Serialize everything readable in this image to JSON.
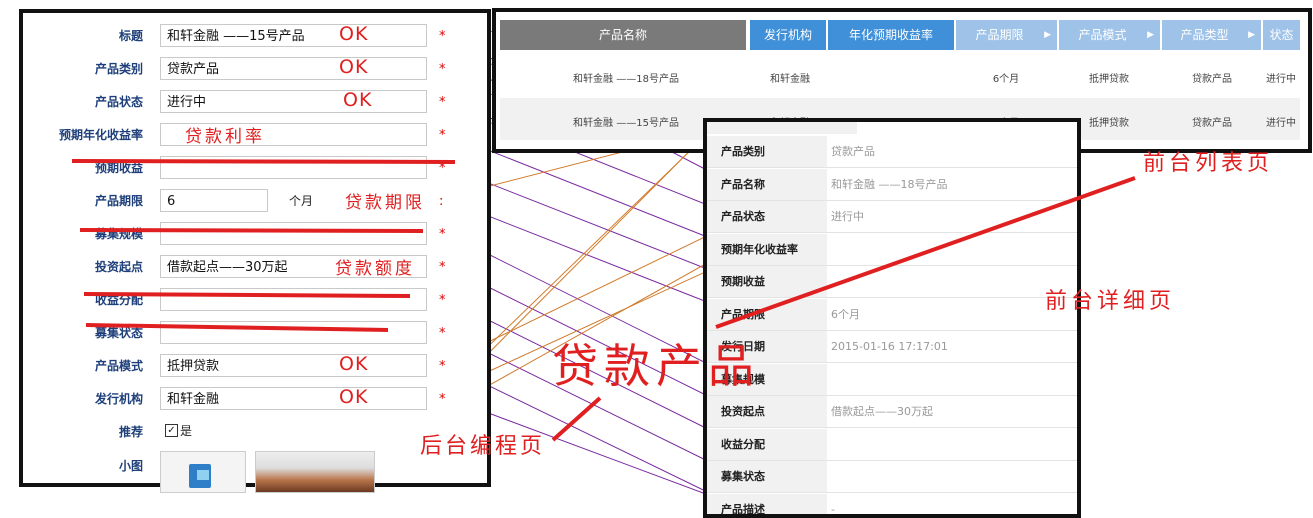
{
  "admin_form": {
    "rows": [
      {
        "label": "标题",
        "value": "和轩金融 ——15号产品",
        "star": "*",
        "note": "OK"
      },
      {
        "label": "产品类别",
        "value": "贷款产品",
        "star": "*",
        "note": "OK"
      },
      {
        "label": "产品状态",
        "value": "进行中",
        "star": "*",
        "note": "OK"
      },
      {
        "label": "预期年化收益率",
        "value": "",
        "star": "*",
        "note": "贷款利率"
      },
      {
        "label": "预期收益",
        "value": "",
        "star": "*",
        "note": ""
      },
      {
        "label": "产品期限",
        "value": "6",
        "unit": "个月",
        "star": ":",
        "note": "贷款期限"
      },
      {
        "label": "募集规模",
        "value": "",
        "star": "*",
        "note": ""
      },
      {
        "label": "投资起点",
        "value": "借款起点——30万起",
        "star": "*",
        "note": "贷款额度"
      },
      {
        "label": "收益分配",
        "value": "",
        "star": "*",
        "note": ""
      },
      {
        "label": "募集状态",
        "value": "",
        "star": "*",
        "note": ""
      },
      {
        "label": "产品模式",
        "value": "抵押贷款",
        "star": "*",
        "note": "OK"
      },
      {
        "label": "发行机构",
        "value": "和轩金融",
        "star": "*",
        "note": "OK"
      }
    ],
    "recommend": {
      "label": "推荐",
      "checkbox": "✓",
      "option": "是"
    },
    "thumbnail": {
      "label": "小图"
    }
  },
  "list_page": {
    "headers": [
      "产品名称",
      "发行机构",
      "年化预期收益率",
      "产品期限",
      "产品模式",
      "产品类型",
      "状态"
    ],
    "header_colors": [
      "#7a7a7a",
      "#3f8fd9",
      "#3f8fd9",
      "#9ec2e8",
      "#9ec2e8",
      "#9ec2e8",
      "#9ec2e8"
    ],
    "rows": [
      [
        "和轩金融 ——18号产品",
        "和轩金融",
        "",
        "6个月",
        "抵押贷款",
        "贷款产品",
        "进行中"
      ],
      [
        "和轩金融 ——15号产品",
        "和轩金融",
        "",
        "6个月",
        "抵押贷款",
        "贷款产品",
        "进行中"
      ]
    ]
  },
  "detail_page": {
    "rows": [
      {
        "key": "产品类别",
        "value": "贷款产品"
      },
      {
        "key": "产品名称",
        "value": "和轩金融 ——18号产品"
      },
      {
        "key": "产品状态",
        "value": "进行中"
      },
      {
        "key": "预期年化收益率",
        "value": ""
      },
      {
        "key": "预期收益",
        "value": ""
      },
      {
        "key": "产品期限",
        "value": "6个月"
      },
      {
        "key": "发行日期",
        "value": "2015-01-16 17:17:01"
      },
      {
        "key": "募集规模",
        "value": ""
      },
      {
        "key": "投资起点",
        "value": "借款起点——30万起"
      },
      {
        "key": "收益分配",
        "value": ""
      },
      {
        "key": "募集状态",
        "value": ""
      },
      {
        "key": "产品描述",
        "value": "-"
      }
    ]
  },
  "annotations": {
    "list_title": "前台列表页",
    "detail_title": "前台详细页",
    "center_title": "贷款产品",
    "admin_title": "后台编程页"
  },
  "colors": {
    "red": "#e02020",
    "purple": "#7a2aa0",
    "orange": "#d27a2a",
    "frame": "#111111"
  }
}
